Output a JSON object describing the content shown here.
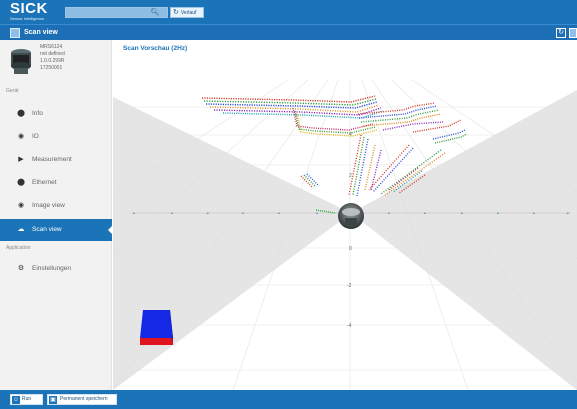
{
  "brand": {
    "name": "SICK",
    "tagline": "Sensor Intelligence."
  },
  "search": {
    "value": "",
    "placeholder": "",
    "history_label": "Verlauf"
  },
  "page": {
    "title": "Scan view"
  },
  "device": {
    "lines": [
      "MRS6124",
      "not defined",
      "1.0.0.299R",
      "17250001"
    ]
  },
  "sidebar": {
    "section_device": "Gerät",
    "section_application": "Application",
    "items": [
      {
        "label": "Info",
        "icon": "info-icon"
      },
      {
        "label": "IO",
        "icon": "io-icon"
      },
      {
        "label": "Measurement",
        "icon": "play-icon"
      },
      {
        "label": "Ethernet",
        "icon": "ethernet-icon"
      },
      {
        "label": "Image view",
        "icon": "eye-icon"
      },
      {
        "label": "Scan view",
        "icon": "cloud-icon",
        "active": true
      }
    ],
    "app_items": [
      {
        "label": "Einstellungen",
        "icon": "gears-icon"
      }
    ]
  },
  "main": {
    "title": "Scan Vorschau (2Hz)",
    "axis_labels": [
      "4",
      "2",
      "0",
      "-2",
      "-4"
    ]
  },
  "footer": {
    "run_label": "Run",
    "save_label": "Permanent speichern"
  },
  "colors": {
    "brand_blue": "#1b73b8",
    "cube_blue": "#1428e6",
    "cube_red": "#e0141e"
  }
}
